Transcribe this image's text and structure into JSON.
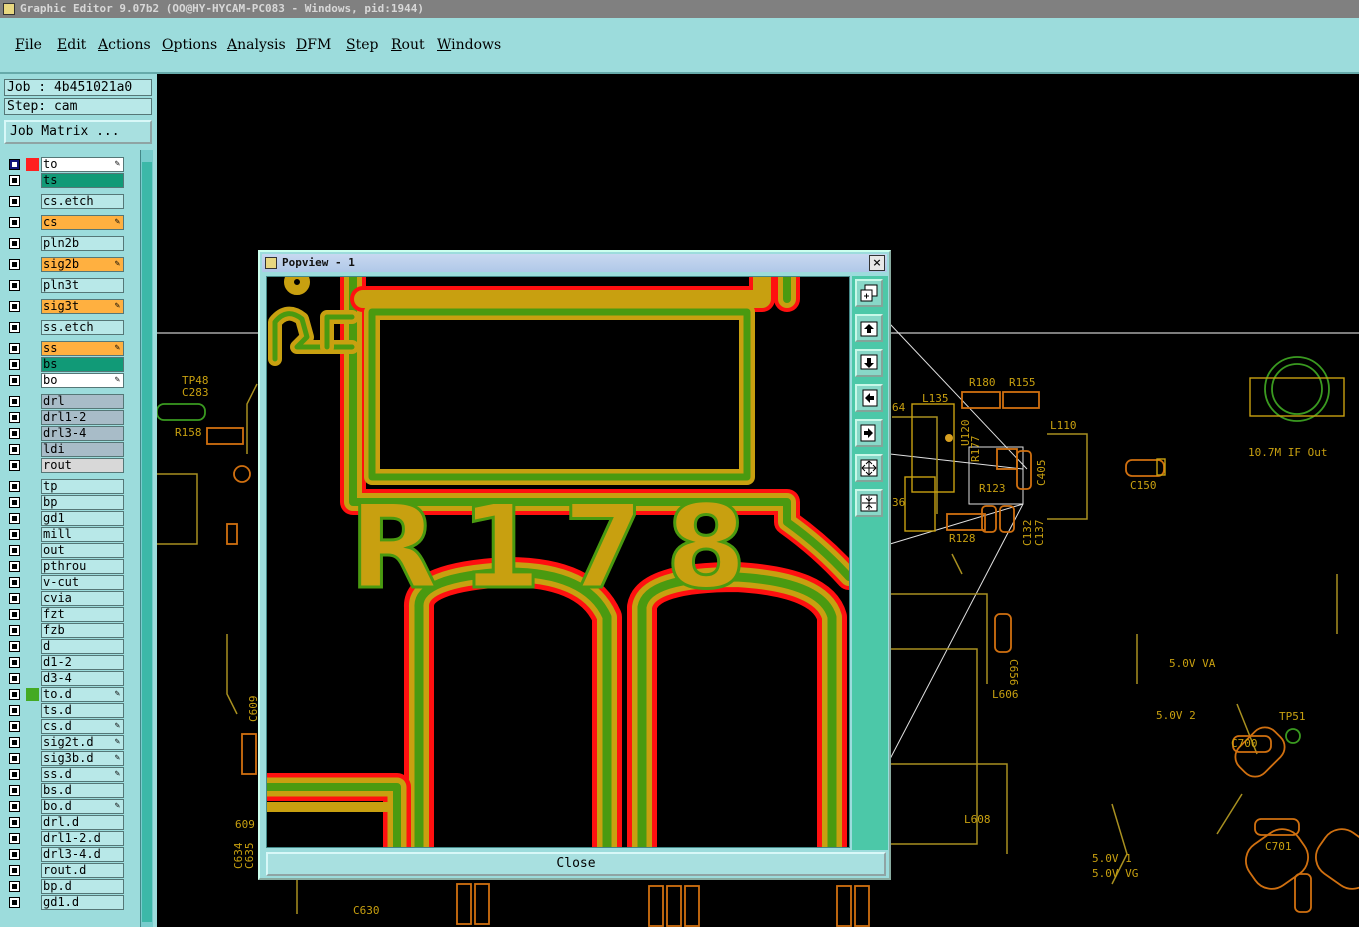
{
  "window_title": "Graphic Editor 9.07b2 (OO@HY-HYCAM-PC083 - Windows, pid:1944)",
  "menu": [
    "File",
    "Edit",
    "Actions",
    "Options",
    "Analysis",
    "DFM",
    "Step",
    "Rout",
    "Windows"
  ],
  "job": "Job : 4b451021a0",
  "step": "Step: cam",
  "job_matrix": "Job Matrix ...",
  "layers": [
    {
      "name": "to",
      "color": "#ffffff",
      "swatch": "#ff2020",
      "editable": true,
      "selected": true
    },
    {
      "name": "ts",
      "color": "#119a77",
      "swatch": "",
      "editable": false
    },
    {
      "name": "cs.etch",
      "color": "#b8e8e8",
      "swatch": "",
      "editable": false
    },
    {
      "name": "cs",
      "color": "#ffb040",
      "swatch": "",
      "editable": true
    },
    {
      "name": "pln2b",
      "color": "#b8e8e8",
      "swatch": "",
      "editable": false
    },
    {
      "name": "sig2b",
      "color": "#ffb040",
      "swatch": "",
      "editable": true
    },
    {
      "name": "pln3t",
      "color": "#b8e8e8",
      "swatch": "",
      "editable": false
    },
    {
      "name": "sig3t",
      "color": "#ffb040",
      "swatch": "",
      "editable": true
    },
    {
      "name": "ss.etch",
      "color": "#b8e8e8",
      "swatch": "",
      "editable": false
    },
    {
      "name": "ss",
      "color": "#ffb040",
      "swatch": "",
      "editable": true
    },
    {
      "name": "bs",
      "color": "#119a77",
      "swatch": "",
      "editable": false
    },
    {
      "name": "bo",
      "color": "#ffffff",
      "swatch": "",
      "editable": true
    },
    {
      "name": "drl",
      "color": "#a8bcc8",
      "swatch": "",
      "editable": false
    },
    {
      "name": "drl1-2",
      "color": "#a8bcc8",
      "swatch": "",
      "editable": false
    },
    {
      "name": "drl3-4",
      "color": "#a8bcc8",
      "swatch": "",
      "editable": false
    },
    {
      "name": "ldi",
      "color": "#a8bcc8",
      "swatch": "",
      "editable": false
    },
    {
      "name": "rout",
      "color": "#d8d8d8",
      "swatch": "",
      "editable": false
    },
    {
      "name": "tp",
      "color": "#b8e8e8",
      "swatch": "",
      "editable": false
    },
    {
      "name": "bp",
      "color": "#b8e8e8",
      "swatch": "",
      "editable": false
    },
    {
      "name": "gd1",
      "color": "#b8e8e8",
      "swatch": "",
      "editable": false
    },
    {
      "name": "mill",
      "color": "#b8e8e8",
      "swatch": "",
      "editable": false
    },
    {
      "name": "out",
      "color": "#b8e8e8",
      "swatch": "",
      "editable": false
    },
    {
      "name": "pthrou",
      "color": "#b8e8e8",
      "swatch": "",
      "editable": false
    },
    {
      "name": "v-cut",
      "color": "#b8e8e8",
      "swatch": "",
      "editable": false
    },
    {
      "name": "cvia",
      "color": "#b8e8e8",
      "swatch": "",
      "editable": false
    },
    {
      "name": "fzt",
      "color": "#b8e8e8",
      "swatch": "",
      "editable": false
    },
    {
      "name": "fzb",
      "color": "#b8e8e8",
      "swatch": "",
      "editable": false
    },
    {
      "name": "d",
      "color": "#b8e8e8",
      "swatch": "",
      "editable": false
    },
    {
      "name": "d1-2",
      "color": "#b8e8e8",
      "swatch": "",
      "editable": false
    },
    {
      "name": "d3-4",
      "color": "#b8e8e8",
      "swatch": "",
      "editable": false
    },
    {
      "name": "to.d",
      "color": "#b8e8e8",
      "swatch": "#44aa22",
      "editable": true
    },
    {
      "name": "ts.d",
      "color": "#b8e8e8",
      "swatch": "",
      "editable": false
    },
    {
      "name": "cs.d",
      "color": "#b8e8e8",
      "swatch": "",
      "editable": true
    },
    {
      "name": "sig2t.d",
      "color": "#b8e8e8",
      "swatch": "",
      "editable": true
    },
    {
      "name": "sig3b.d",
      "color": "#b8e8e8",
      "swatch": "",
      "editable": true
    },
    {
      "name": "ss.d",
      "color": "#b8e8e8",
      "swatch": "",
      "editable": true
    },
    {
      "name": "bs.d",
      "color": "#b8e8e8",
      "swatch": "",
      "editable": false
    },
    {
      "name": "bo.d",
      "color": "#b8e8e8",
      "swatch": "",
      "editable": true
    },
    {
      "name": "drl.d",
      "color": "#b8e8e8",
      "swatch": "",
      "editable": false
    },
    {
      "name": "drl1-2.d",
      "color": "#b8e8e8",
      "swatch": "",
      "editable": false
    },
    {
      "name": "drl3-4.d",
      "color": "#b8e8e8",
      "swatch": "",
      "editable": false
    },
    {
      "name": "rout.d",
      "color": "#b8e8e8",
      "swatch": "",
      "editable": false
    },
    {
      "name": "bp.d",
      "color": "#b8e8e8",
      "swatch": "",
      "editable": false
    },
    {
      "name": "gd1.d",
      "color": "#b8e8e8",
      "swatch": "",
      "editable": false
    }
  ],
  "board_labels": [
    "TP48",
    "C283",
    "R158",
    "L135",
    "U120",
    "R180",
    "R155",
    "L110",
    "10.7M IF Out",
    "C150",
    "R128",
    "C132",
    "C137",
    "C405",
    "R123",
    "R177",
    "64",
    "36",
    "C656",
    "L606",
    "5.0V VA",
    "5.0V 2",
    "TP51",
    "C700",
    "L608",
    "C701",
    "5.0V 1",
    "5.0V VG",
    "C630",
    "C634",
    "C635",
    "609",
    "C609"
  ],
  "popview": {
    "title": "Popview - 1",
    "close_x": "×",
    "close_button": "Close",
    "zoom_label": "R178",
    "tools": [
      "zoom-fit-icon",
      "pan-up-icon",
      "pan-down-icon",
      "pan-left-icon",
      "pan-right-icon",
      "zoom-in-icon",
      "zoom-out-icon"
    ]
  },
  "colors": {
    "gui": "#9cdcdc",
    "layer_red": "#ff1010",
    "layer_gold": "#c8a010",
    "layer_green": "#4a9a10",
    "trace": "#a89020"
  }
}
